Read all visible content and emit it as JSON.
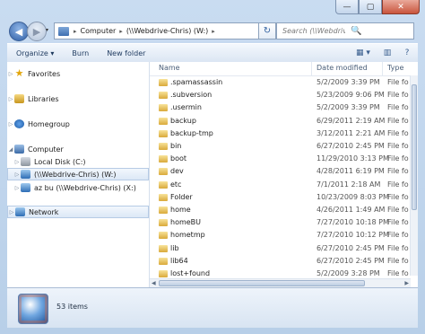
{
  "window": {
    "buttons": {
      "minimize": "—",
      "maximize": "▢",
      "close": "✕"
    }
  },
  "nav": {
    "back_glyph": "◀",
    "forward_glyph": "▶",
    "recent_glyph": "▾"
  },
  "address": {
    "crumbs": [
      "Computer",
      "(\\\\Webdrive-Chris) (W:)"
    ],
    "separator": "▸",
    "dropdown": "▾",
    "refresh_glyph": "↻"
  },
  "search": {
    "placeholder": "Search (\\\\Webdrive-Chris) (W:)",
    "icon": "🔍"
  },
  "toolbar": {
    "organize": "Organize ▾",
    "burn": "Burn",
    "new_folder": "New folder",
    "view_glyph": "▦ ▾",
    "pane_glyph": "▥",
    "help_glyph": "?"
  },
  "navpane": {
    "items": [
      {
        "label": "Favorites",
        "icon": "star-icon"
      },
      {
        "label": "Libraries",
        "icon": "library-icon"
      },
      {
        "label": "Homegroup",
        "icon": "homegroup-icon"
      },
      {
        "label": "Computer",
        "icon": "computer-icon"
      },
      {
        "label": "Local Disk (C:)",
        "icon": "disk-icon"
      },
      {
        "label": "(\\\\Webdrive-Chris) (W:)",
        "icon": "network-drive-icon"
      },
      {
        "label": "az bu (\\\\Webdrive-Chris) (X:)",
        "icon": "network-drive-icon"
      },
      {
        "label": "Network",
        "icon": "network-icon"
      }
    ]
  },
  "filelist": {
    "columns": {
      "name": "Name",
      "date": "Date modified",
      "type": "Type"
    },
    "rows": [
      {
        "name": ".spamassassin",
        "date": "5/2/2009 3:39 PM",
        "type": "File fo"
      },
      {
        "name": ".subversion",
        "date": "5/23/2009 9:06 PM",
        "type": "File fo"
      },
      {
        "name": ".usermin",
        "date": "5/2/2009 3:39 PM",
        "type": "File fo"
      },
      {
        "name": "backup",
        "date": "6/29/2011 2:19 AM",
        "type": "File fo"
      },
      {
        "name": "backup-tmp",
        "date": "3/12/2011 2:21 AM",
        "type": "File fo"
      },
      {
        "name": "bin",
        "date": "6/27/2010 2:45 PM",
        "type": "File fo"
      },
      {
        "name": "boot",
        "date": "11/29/2010 3:13 PM",
        "type": "File fo"
      },
      {
        "name": "dev",
        "date": "4/28/2011 6:19 PM",
        "type": "File fo"
      },
      {
        "name": "etc",
        "date": "7/1/2011 2:18 AM",
        "type": "File fo"
      },
      {
        "name": "Folder",
        "date": "10/23/2009 8:03 PM",
        "type": "File fo"
      },
      {
        "name": "home",
        "date": "4/26/2011 1:49 AM",
        "type": "File fo"
      },
      {
        "name": "homeBU",
        "date": "7/27/2010 10:18 PM",
        "type": "File fo"
      },
      {
        "name": "hometmp",
        "date": "7/27/2010 10:12 PM",
        "type": "File fo"
      },
      {
        "name": "lib",
        "date": "6/27/2010 2:45 PM",
        "type": "File fo"
      },
      {
        "name": "lib64",
        "date": "6/27/2010 2:45 PM",
        "type": "File fo"
      },
      {
        "name": "lost+found",
        "date": "5/2/2009 3:28 PM",
        "type": "File fo"
      }
    ]
  },
  "details": {
    "count": "53 items"
  }
}
